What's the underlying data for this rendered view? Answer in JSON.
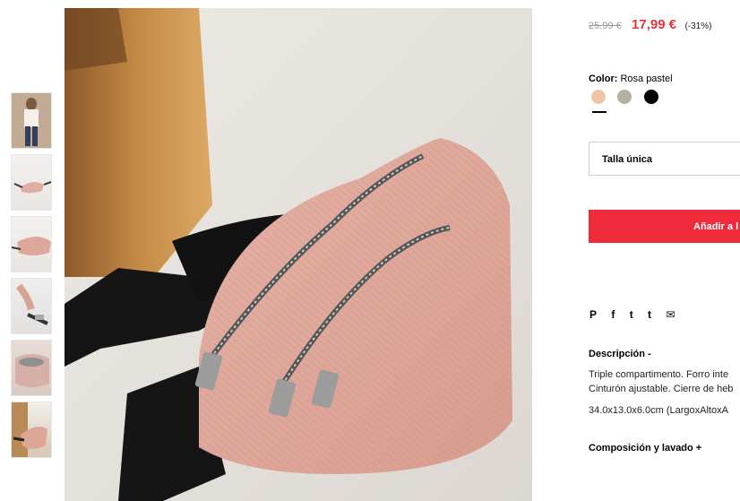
{
  "product": {
    "price_old": "25,99 €",
    "price_new": "17,99 €",
    "discount": "(-31%)",
    "color_label": "Color:",
    "color_value": "Rosa pastel",
    "swatches": [
      {
        "name": "rosa",
        "hex": "#f2c4a6"
      },
      {
        "name": "gris",
        "hex": "#b6b0a3"
      },
      {
        "name": "negro",
        "hex": "#050505"
      }
    ],
    "size_value": "Talla única",
    "add_button_label": "Añadir a l"
  },
  "share": {
    "icons": [
      "pinterest-icon",
      "facebook-icon",
      "twitter-icon",
      "tumblr-icon",
      "mail-icon"
    ],
    "glyphs": [
      "P",
      "f",
      "t",
      "t",
      "✉"
    ]
  },
  "description": {
    "heading": "Descripción -",
    "line1": "Triple compartimento. Forro inte",
    "line2": "Cinturón ajustable. Cierre de heb",
    "line3": "34.0x13.0x6.0cm (LargoxAltoxA"
  },
  "composition": {
    "heading": "Composición y lavado +"
  },
  "colors": {
    "sale_red": "#e3333d",
    "button_red": "#ef2b3b"
  }
}
